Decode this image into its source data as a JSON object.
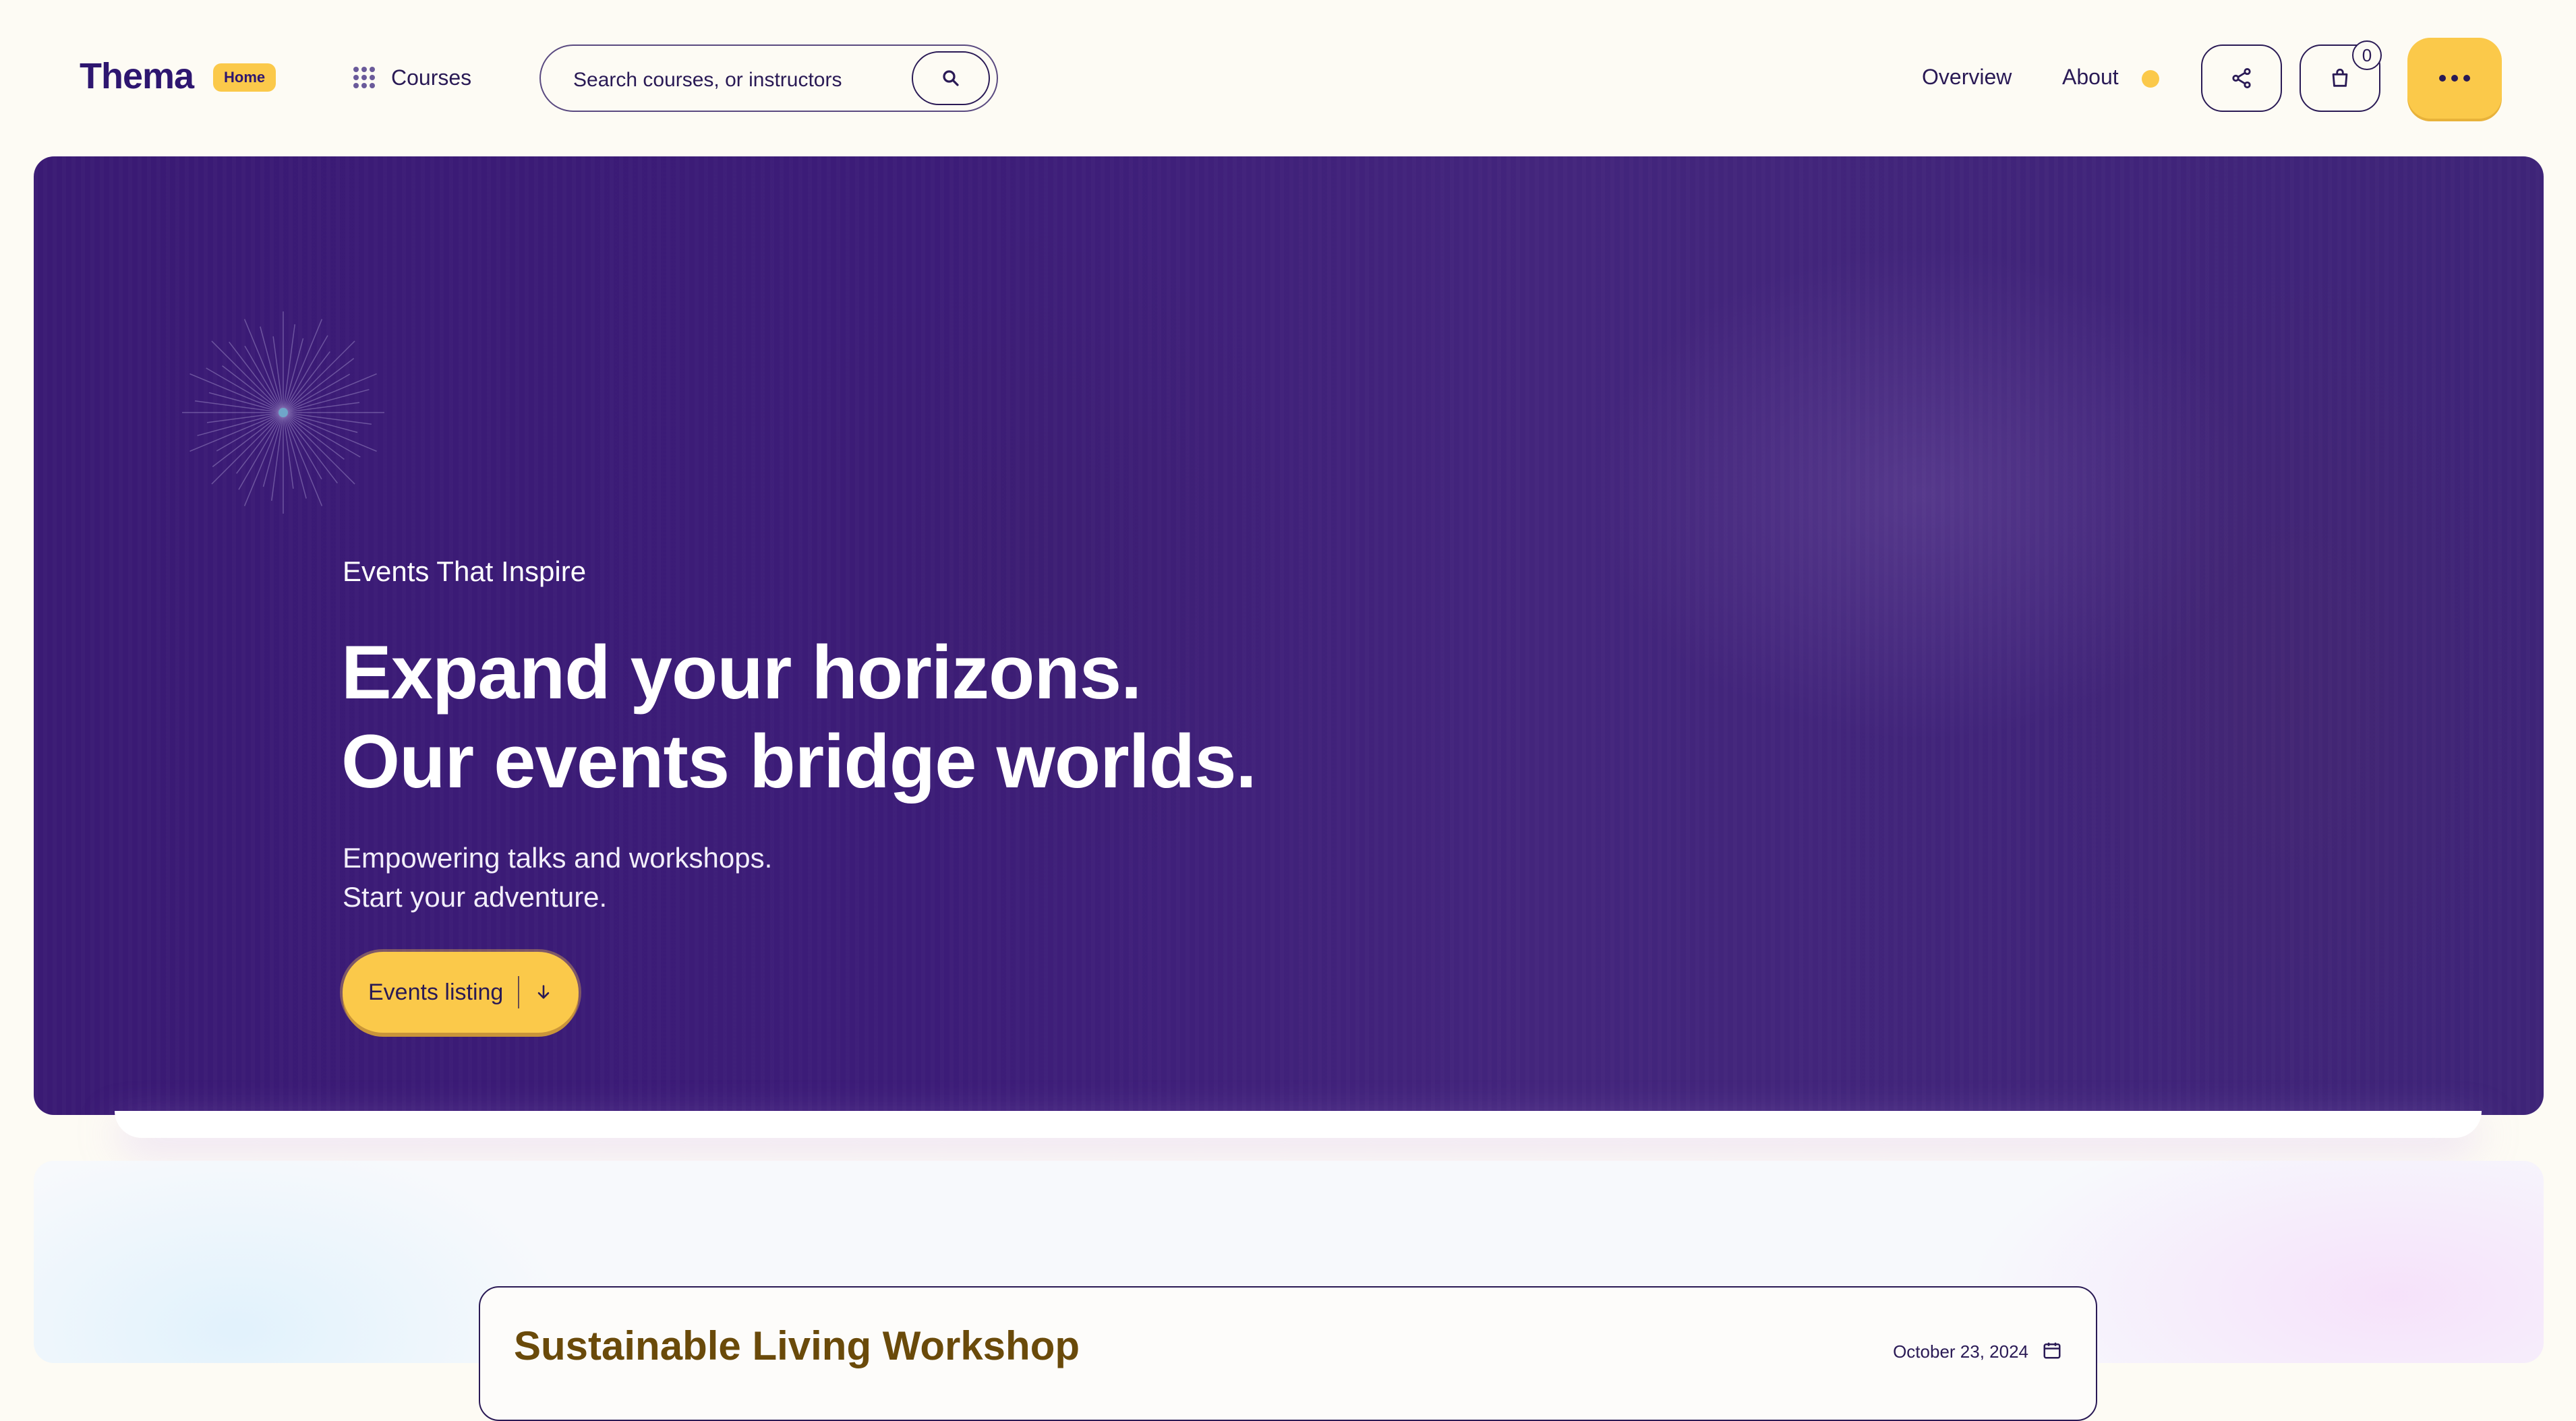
{
  "header": {
    "logo": "Thema",
    "logo_badge": "Home",
    "courses_label": "Courses",
    "search_placeholder": "Search courses, or instructors",
    "nav": {
      "overview": "Overview",
      "about": "About"
    },
    "cart_count": "0"
  },
  "hero": {
    "eyebrow": "Events That Inspire",
    "headline_line1": "Expand your horizons.",
    "headline_line2": "Our events bridge worlds.",
    "subtext_line1": "Empowering talks and workshops.",
    "subtext_line2": "Start your adventure.",
    "cta_label": "Events listing"
  },
  "events": [
    {
      "title": "Sustainable Living Workshop",
      "date": "October 23, 2024"
    }
  ],
  "colors": {
    "background": "#fdfbf4",
    "brand": "#2e1670",
    "accent": "#fbc94a",
    "hero": "#3a1a74",
    "event_title": "#6a4a0a"
  },
  "icons": [
    "grid-icon",
    "search-icon",
    "share-icon",
    "shopping-bag-icon",
    "more-icon",
    "arrow-down-icon",
    "calendar-icon",
    "sparkle-icon"
  ]
}
